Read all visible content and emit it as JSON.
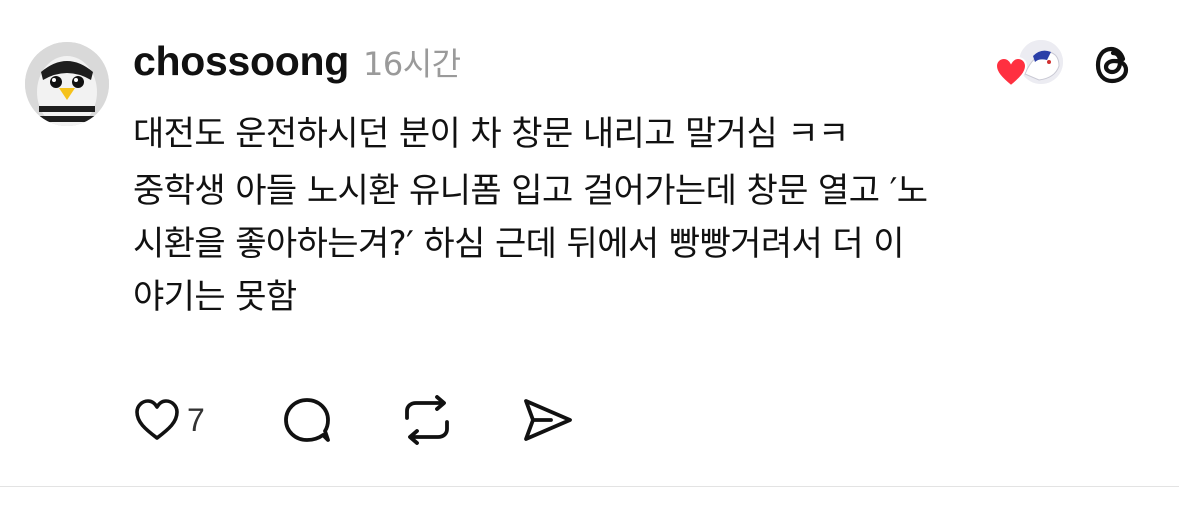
{
  "post": {
    "username": "chossoong",
    "time": "16시간",
    "content_lines": [
      "대전도 운전하시던 분이 차 창문 내리고 말거심 ㅋㅋ",
      "중학생 아들 노시환 유니폼 입고 걸어가는데 창문 열고 ′노",
      "시환을 좋아하는겨?′ 하심 근데 뒤에서 빵빵거려서 더 이",
      "야기는 못함"
    ],
    "like_count": "7"
  },
  "icons": {
    "avatar": "avatar-image",
    "liker": "liker-avatar",
    "liked": "heart-icon",
    "app": "threads-logo-icon",
    "like": "heart-outline-icon",
    "reply": "comment-bubble-icon",
    "repost": "repost-icon",
    "share": "send-icon"
  },
  "colors": {
    "text": "#111111",
    "muted": "#9a9a9a",
    "heart": "#ff3040",
    "divider": "#e3e3e3"
  }
}
